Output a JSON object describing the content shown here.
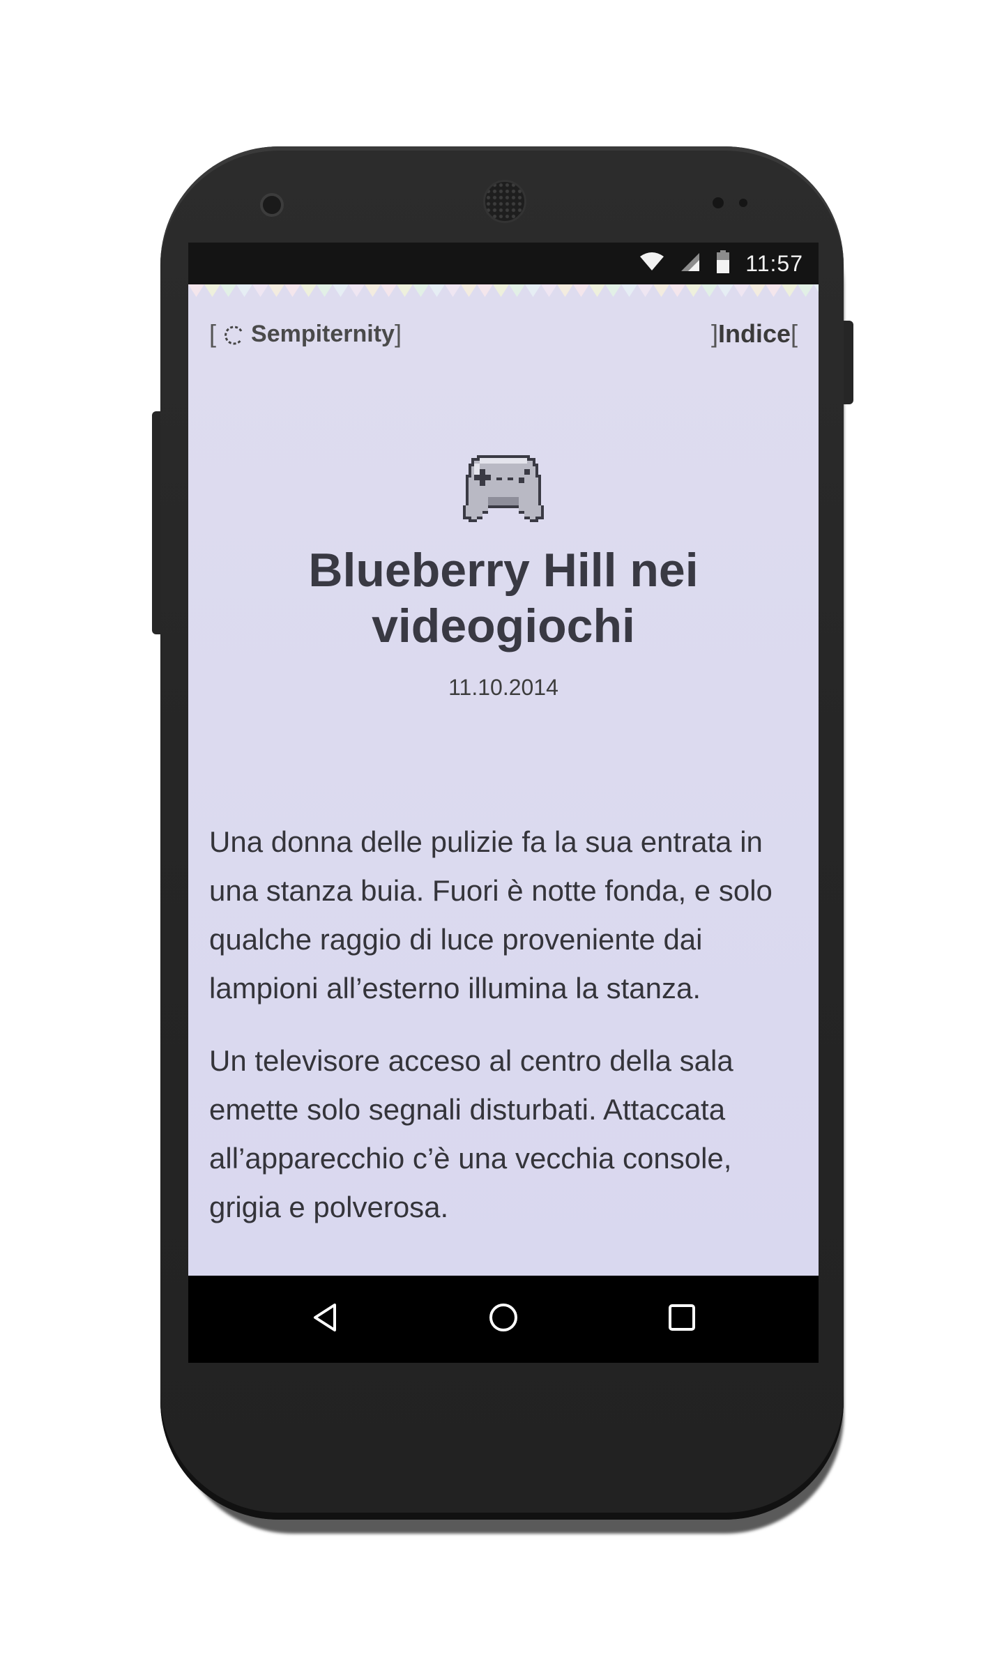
{
  "status_bar": {
    "time": "11:57",
    "icons": [
      "wifi-icon",
      "cell-signal-icon",
      "battery-icon"
    ]
  },
  "header": {
    "brand_open_bracket": "[",
    "brand_name": "Sempiternity",
    "brand_close_bracket": "]",
    "index_open_bracket": "]",
    "index_label": "Indice",
    "index_close_bracket": "["
  },
  "article": {
    "icon": "gamepad-icon",
    "title": "Blueberry Hill nei videogiochi",
    "date": "11.10.2014",
    "paragraphs": [
      "Una donna delle pulizie fa la sua entrata in una stanza buia. Fuori è notte fonda, e solo qualche raggio di luce proveniente dai lampioni all’esterno illumina la stanza.",
      "Un televisore acceso al centro della sala emette solo segnali disturbati. Attaccata all’apparecchio c’è una vecchia console, grigia e polverosa."
    ]
  },
  "nav_bar": {
    "buttons": [
      "back-icon",
      "home-icon",
      "recents-icon"
    ]
  },
  "colors": {
    "page_background": "#dddcef",
    "text": "#393943",
    "status_bar": "#141414",
    "nav_bar": "#000000",
    "phone_body": "#2a2a2a"
  }
}
